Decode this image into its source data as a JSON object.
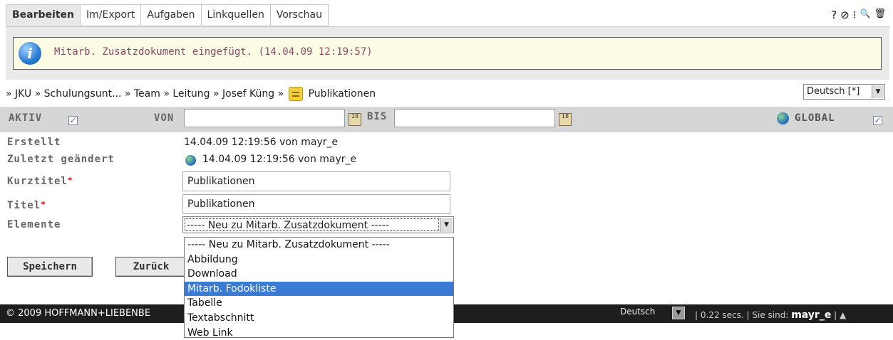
{
  "tabs": [
    {
      "label": "Bearbeiten",
      "active": true
    },
    {
      "label": "Im/Export",
      "active": false
    },
    {
      "label": "Aufgaben",
      "active": false
    },
    {
      "label": "Linkquellen",
      "active": false
    },
    {
      "label": "Vorschau",
      "active": false
    }
  ],
  "toolbar": {
    "help": "?",
    "icon2": "⊘",
    "icon3": "⁝",
    "search": "🔍",
    "trash": "🗑"
  },
  "message": {
    "text": "Mitarb. Zusatzdokument eingefügt. (14.04.09 12:19:57)",
    "icon": "i"
  },
  "breadcrumb": {
    "items": [
      "» JKU",
      "» Schulungsunt...",
      "» Team",
      "» Leitung",
      "» Josef Küng",
      "»"
    ],
    "current": "Publikationen"
  },
  "language_select": {
    "value": "Deutsch [*]"
  },
  "filter": {
    "aktiv_label": "AKTIV",
    "aktiv_checked": true,
    "von_label": "VON",
    "von_value": "",
    "bis_label": "BIS",
    "bis_value": "",
    "global_label": "GLOBAL",
    "global_checked": true,
    "cal_glyph": "18"
  },
  "fields": {
    "erstellt_label": "Erstellt",
    "erstellt_value": "14.04.09 12:19:56 von mayr_e",
    "geaendert_label": "Zuletzt geändert",
    "geaendert_value": "14.04.09 12:19:56 von mayr_e",
    "kurztitel_label": "Kurztitel",
    "kurztitel_value": "Publikationen",
    "titel_label": "Titel",
    "titel_value": "Publikationen",
    "elemente_label": "Elemente",
    "elemente_value": "----- Neu zu Mitarb. Zusatzdokument -----",
    "required_mark": "*"
  },
  "elemente_options": [
    "----- Neu zu Mitarb. Zusatzdokument -----",
    "Abbildung",
    "Download",
    "Mitarb. Fodokliste",
    "Tabelle",
    "Textabschnitt",
    "Web Link"
  ],
  "elemente_highlighted": "Mitarb. Fodokliste",
  "buttons": {
    "save": "Speichern",
    "back": "Zurück"
  },
  "footer": {
    "copyright": "© 2009 HOFFMANN+LIEBENBE",
    "language": "Deutsch",
    "timing": "| 0.22 secs. | Sie sind:",
    "user": "mayr_e",
    "tail": "| ▲"
  },
  "colors": {
    "highlight": "#3a7bd4",
    "message_bg": "#fcfbe3",
    "footer_bg": "#1e1e1e",
    "filter_bg": "#d6d6d6"
  }
}
